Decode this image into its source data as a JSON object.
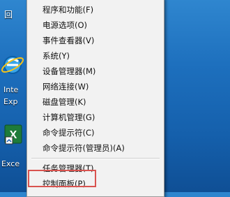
{
  "desktop": {
    "icons": [
      {
        "name": "recycle",
        "label": "回"
      },
      {
        "name": "internet-explorer",
        "label_line1": "Inte",
        "label_line2": "Exp"
      },
      {
        "name": "excel",
        "label": "Exce"
      }
    ]
  },
  "menu": {
    "items": [
      {
        "label": "程序和功能(F)"
      },
      {
        "label": "电源选项(O)"
      },
      {
        "label": "事件查看器(V)"
      },
      {
        "label": "系统(Y)"
      },
      {
        "label": "设备管理器(M)"
      },
      {
        "label": "网络连接(W)"
      },
      {
        "label": "磁盘管理(K)"
      },
      {
        "label": "计算机管理(G)"
      },
      {
        "label": "命令提示符(C)"
      },
      {
        "label": "命令提示符(管理员)(A)"
      },
      {
        "label": "任务管理器(T)"
      },
      {
        "label": "控制面板(P)"
      }
    ]
  },
  "colors": {
    "highlight_border": "#d9534f",
    "desktop_blue": "#1d6fbd"
  }
}
